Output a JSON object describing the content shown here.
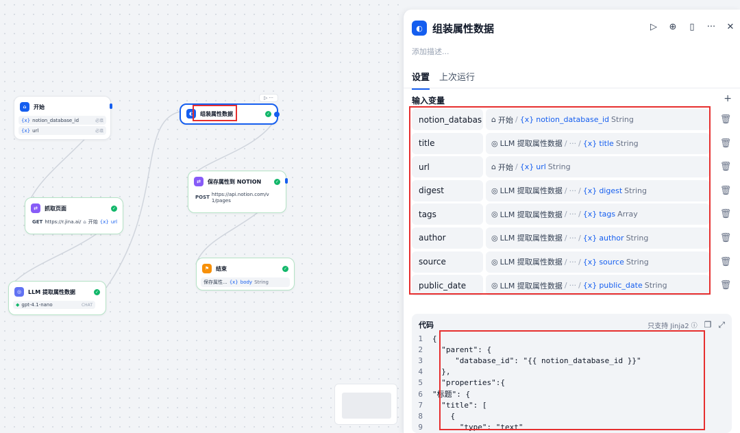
{
  "canvas": {
    "nodes": {
      "start": {
        "title": "开始",
        "icon": "home-icon",
        "rows": [
          {
            "var": "notion_database_id",
            "meta": "必填"
          },
          {
            "var": "url",
            "meta": "必填"
          }
        ]
      },
      "fetch": {
        "title": "抓取页面",
        "icon": "http-icon",
        "method": "GET",
        "url": "https://r.jina.ai/",
        "ref_node": "开始",
        "ref_var": "url"
      },
      "llm": {
        "title": "LLM 提取属性数据",
        "icon": "llm-icon",
        "model": "gpt-4.1-nano",
        "badge": "CHAT"
      },
      "assemble": {
        "title": "组装属性数据",
        "icon": "template-icon"
      },
      "save": {
        "title": "保存属性到 NOTION",
        "icon": "http-icon",
        "method": "POST",
        "url": "https://api.notion.com/v1/pages"
      },
      "end": {
        "title": "结束",
        "icon": "flag-icon",
        "ref_node": "保存属性...",
        "ref_var": "body",
        "ref_type": "String"
      }
    }
  },
  "panel": {
    "title": "组装属性数据",
    "description_placeholder": "添加描述...",
    "tabs": [
      {
        "label": "设置",
        "active": true
      },
      {
        "label": "上次运行",
        "active": false
      }
    ],
    "inputs_label": "输入变量",
    "variables": [
      {
        "name": "notion_databas",
        "source": "开始",
        "source_icon": "home-icon",
        "path": "",
        "var": "notion_database_id",
        "type": "String"
      },
      {
        "name": "title",
        "source": "LLM 提取属性数据",
        "source_icon": "llm-icon",
        "path": "···",
        "var": "title",
        "type": "String"
      },
      {
        "name": "url",
        "source": "开始",
        "source_icon": "home-icon",
        "path": "",
        "var": "url",
        "type": "String"
      },
      {
        "name": "digest",
        "source": "LLM 提取属性数据",
        "source_icon": "llm-icon",
        "path": "···",
        "var": "digest",
        "type": "String"
      },
      {
        "name": "tags",
        "source": "LLM 提取属性数据",
        "source_icon": "llm-icon",
        "path": "···",
        "var": "tags",
        "type": "Array"
      },
      {
        "name": "author",
        "source": "LLM 提取属性数据",
        "source_icon": "llm-icon",
        "path": "···",
        "var": "author",
        "type": "String"
      },
      {
        "name": "source",
        "source": "LLM 提取属性数据",
        "source_icon": "llm-icon",
        "path": "···",
        "var": "source",
        "type": "String"
      },
      {
        "name": "public_date",
        "source": "LLM 提取属性数据",
        "source_icon": "llm-icon",
        "path": "···",
        "var": "public_date",
        "type": "String"
      }
    ],
    "code": {
      "label": "代码",
      "hint": "只支持 Jinja2",
      "lines": [
        "{",
        "  \"parent\": {",
        "     \"database_id\": \"{{ notion_database_id }}\"",
        "  },",
        "  \"properties\":{",
        "\"标题\": {",
        "  \"title\": [",
        "    {",
        "      \"type\": \"text\""
      ]
    }
  },
  "colors": {
    "accent": "#155eef",
    "success": "#12b76a",
    "highlight": "#e62e2e"
  }
}
